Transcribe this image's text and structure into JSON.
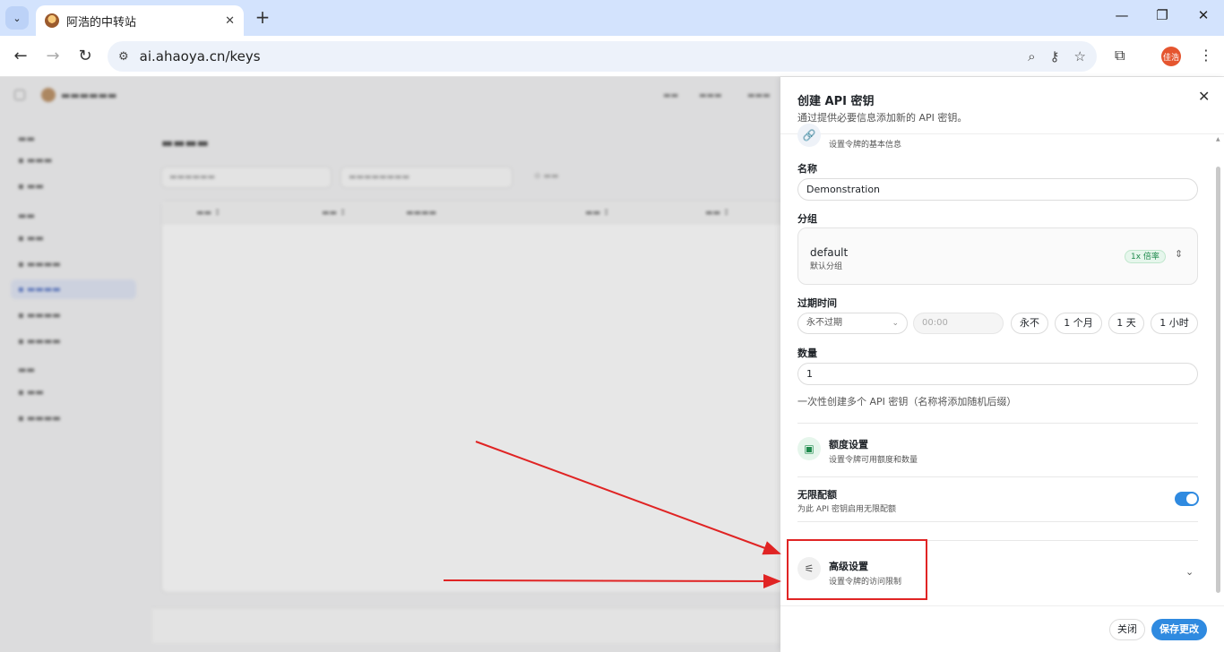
{
  "browser": {
    "tab_title": "阿浩的中转站",
    "tab_close": "✕",
    "new_tab": "+",
    "url": "ai.ahaoya.cn/keys",
    "profile_label": "佳浩",
    "win_min": "—",
    "win_max": "❐",
    "win_close": "✕"
  },
  "sheet": {
    "title": "创建 API 密钥",
    "subtitle": "通过提供必要信息添加新的 API 密钥。",
    "basic_section_sub": "设置令牌的基本信息",
    "name_label": "名称",
    "name_value": "Demonstration",
    "group_label": "分组",
    "group_name": "default",
    "group_desc": "默认分组",
    "group_badge": "1x 倍率",
    "expire_label": "过期时间",
    "expire_select": "永不过期",
    "expire_time_placeholder": "00:00",
    "expire_quick": [
      "永不",
      "1 个月",
      "1 天",
      "1 小时"
    ],
    "quantity_label": "数量",
    "quantity_value": "1",
    "quantity_hint": "一次性创建多个 API 密钥（名称将添加随机后缀）",
    "quota_title": "额度设置",
    "quota_sub": "设置令牌可用额度和数量",
    "unlimited_title": "无限配额",
    "unlimited_sub": "为此 API 密钥启用无限配额",
    "unlimited_on": true,
    "advanced_title": "高级设置",
    "advanced_sub": "设置令牌的访问限制",
    "close_button": "关闭",
    "save_button": "保存更改"
  },
  "colors": {
    "accent": "#2f8ae0",
    "annotation": "#e02424",
    "badge_green": "#1e8a4c"
  }
}
